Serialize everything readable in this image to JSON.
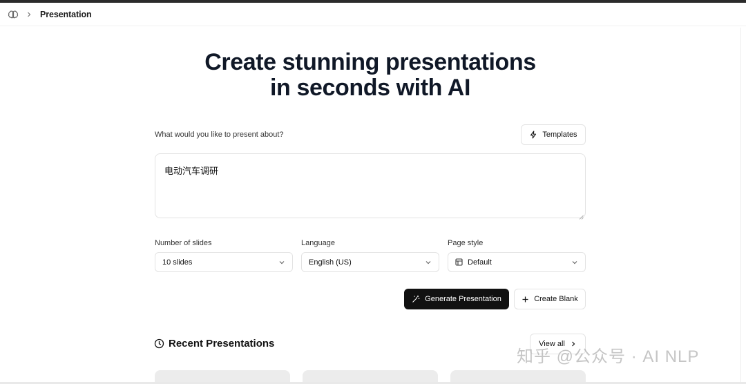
{
  "breadcrumb": {
    "page": "Presentation"
  },
  "hero": {
    "line1": "Create stunning presentations",
    "line2": "in seconds with AI"
  },
  "prompt": {
    "label": "What would you like to present about?",
    "value": "电动汽车调研"
  },
  "templates_button": "Templates",
  "fields": {
    "slides": {
      "label": "Number of slides",
      "value": "10 slides"
    },
    "language": {
      "label": "Language",
      "value": "English (US)"
    },
    "page_style": {
      "label": "Page style",
      "value": "Default"
    }
  },
  "actions": {
    "generate": "Generate Presentation",
    "create_blank": "Create Blank"
  },
  "recent": {
    "title": "Recent Presentations",
    "view_all": "View all"
  },
  "watermark": "知乎 @公众号 · AI NLP",
  "icons": [
    "brain-icon",
    "chevron-right-icon",
    "lightning-icon",
    "chevron-down-icon",
    "layout-icon",
    "magic-wand-icon",
    "plus-icon",
    "clock-icon"
  ]
}
